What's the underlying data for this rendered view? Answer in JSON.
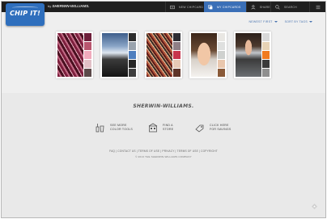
{
  "header": {
    "logo_text": "CHIP IT!",
    "byline_prefix": "by",
    "byline_brand": "SHERWIN-WILLIAMS.",
    "nav": [
      {
        "label": "NEW CHIPCARD",
        "icon": "card-icon",
        "active": false
      },
      {
        "label": "MY CHIPCARDS",
        "icon": "stack-icon",
        "active": true
      },
      {
        "label": "SHARE",
        "icon": "share-icon",
        "active": false
      },
      {
        "label": "SEARCH",
        "icon": "search-icon",
        "active": false
      },
      {
        "label": "",
        "icon": "menu-icon",
        "active": false
      }
    ]
  },
  "sort": {
    "order_label": "NEWEST FIRST",
    "tag_label": "SORT BY TAGS"
  },
  "chipcards": [
    {
      "photo": "abstract-pink-pattern",
      "chips": [
        "#6e1f3a",
        "#b9566f",
        "#f0aabc",
        "#e1c0c6",
        "#5c4a4a"
      ]
    },
    {
      "photo": "city-skyline-night",
      "chips": [
        "#2c2c2c",
        "#9aa3ad",
        "#4f7fbf",
        "#262626",
        "#3f3f3f"
      ]
    },
    {
      "photo": "striped-red-fabric",
      "chips": [
        "#2e2d33",
        "#8f7f86",
        "#c7354d",
        "#e7c9b6",
        "#5e3428"
      ]
    },
    {
      "photo": "smiling-girl-portrait",
      "chips": [
        "#e9e7e3",
        "#dfe0df",
        "#cfd1cf",
        "#e9c7ad",
        "#8a5a38"
      ]
    },
    {
      "photo": "girl-outdoors-portrait",
      "chips": [
        "#d9d9d9",
        "#e7d3b6",
        "#f07a1f",
        "#3a3a3a",
        "#8f8f8f"
      ]
    }
  ],
  "footer": {
    "brand": "SHERWIN-WILLIAMS.",
    "tools": [
      {
        "line1": "SEE MORE",
        "line2": "COLOR TOOLS",
        "icon": "paint-tools-icon"
      },
      {
        "line1": "FIND A",
        "line2": "STORE",
        "icon": "store-icon"
      },
      {
        "line1": "CLICK HERE",
        "line2": "FOR SAVINGS",
        "icon": "savings-icon"
      }
    ],
    "legal": "FAQ | CONTACT US | TERMS OF USE | PRIVACY | TERMS OF USE | COPYRIGHT",
    "copyright": "© 2013 THE SHERWIN-WILLIAMS COMPANY"
  }
}
